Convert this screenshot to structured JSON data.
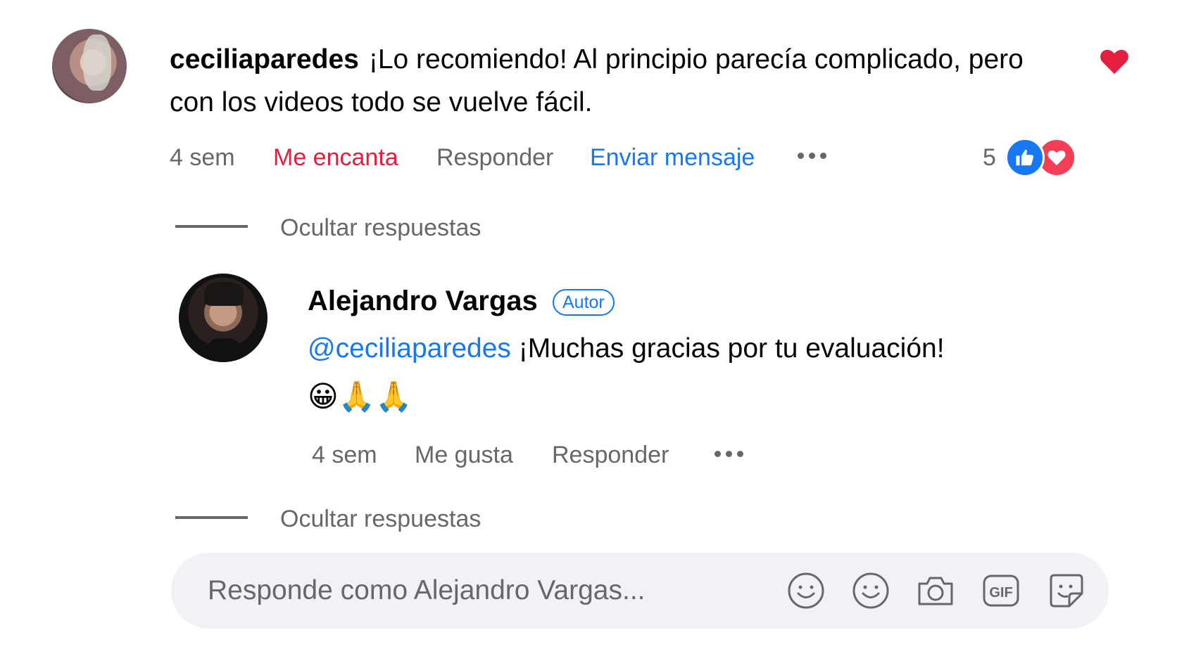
{
  "comment": {
    "author": "ceciliaparedes",
    "text": "¡Lo recomiendo! Al principio parecía complicado, pero con los videos todo se vuelve fácil.",
    "time": "4 sem",
    "love_label": "Me encanta",
    "reply_label": "Responder",
    "message_label": "Enviar mensaje",
    "reaction_count": "5",
    "reacted_icon": "heart-icon",
    "reaction_icons": [
      "like-icon",
      "love-icon"
    ]
  },
  "replies_toggle": {
    "label_1": "Ocultar respuestas",
    "label_2": "Ocultar respuestas"
  },
  "reply": {
    "author": "Alejandro Vargas",
    "badge": "Autor",
    "mention": "@ceciliaparedes",
    "text": " ¡Muchas gracias por tu evaluación!",
    "emojis": "😀🙏🙏",
    "time": "4 sem",
    "like_label": "Me gusta",
    "reply_label": "Responder"
  },
  "composer": {
    "placeholder": "Responde como Alejandro Vargas...",
    "tools": [
      "emoji-icon",
      "emoji-icon",
      "camera-icon",
      "gif-icon",
      "sticker-icon"
    ]
  },
  "colors": {
    "link_blue": "#1877f2",
    "love_red": "#e41e3f",
    "secondary_text": "#65676b",
    "composer_bg": "#f0f2f5"
  }
}
